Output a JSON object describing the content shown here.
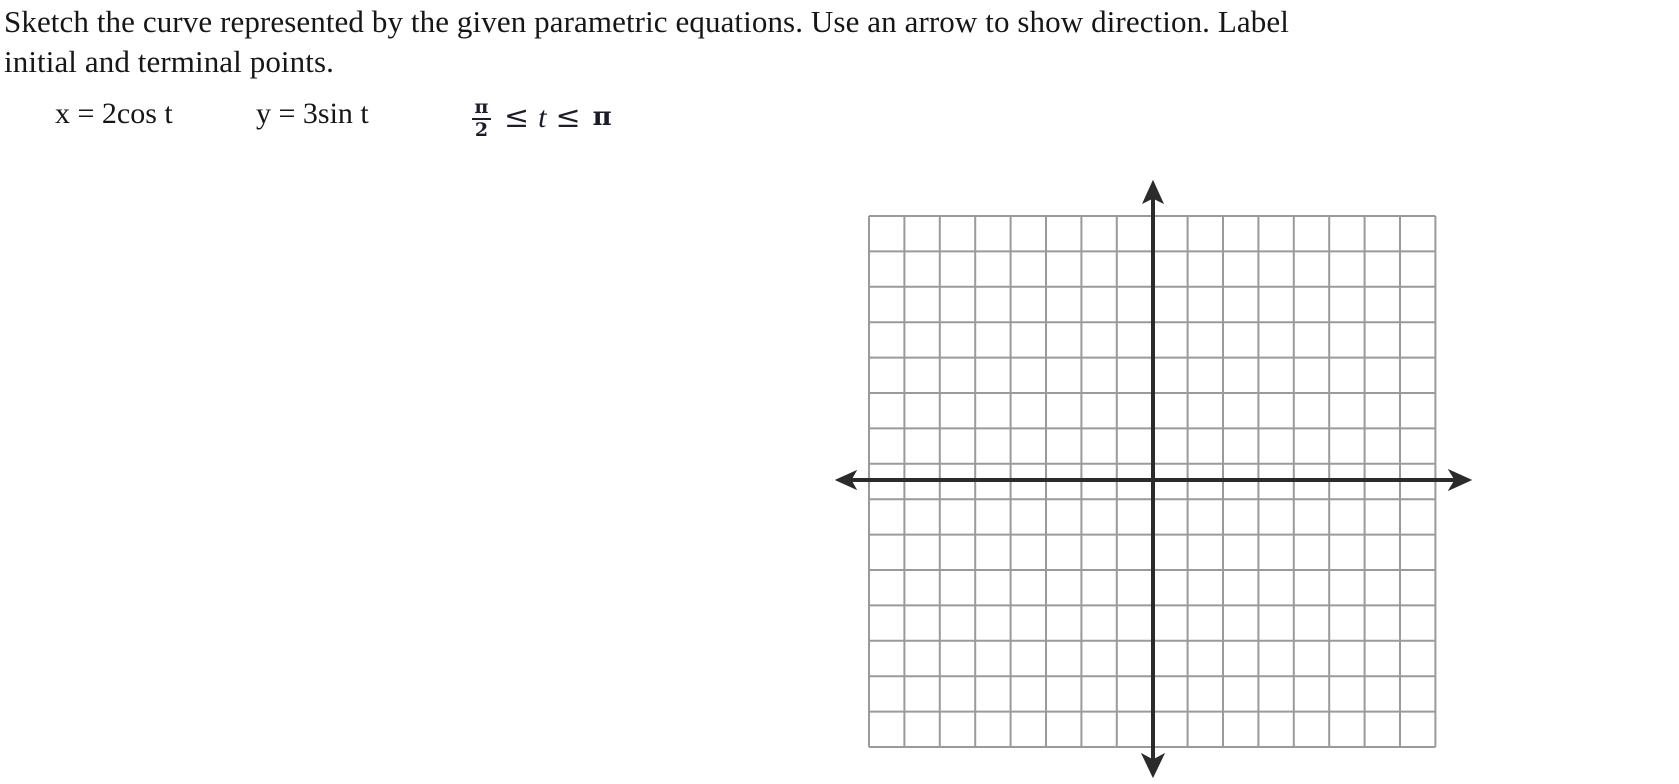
{
  "problem": {
    "line1": "Sketch the curve represented by the given parametric equations. Use an arrow to show direction. Label",
    "line2": "initial and terminal points."
  },
  "equations": {
    "x_equation": "x = 2cos t",
    "y_equation": "y = 3sin t",
    "domain": {
      "numerator": "π",
      "denominator": "2",
      "relation_left": "≤",
      "parameter": "t",
      "relation_right": "≤",
      "upper_bound": "π",
      "full_text": "π/2 ≤ t ≤ π"
    }
  },
  "graph": {
    "label": "blank coordinate grid",
    "grid": {
      "columns": 16,
      "rows": 15,
      "cell_size_px": 35.4,
      "columns_left_of_y_axis": 8,
      "columns_right_of_y_axis": 8,
      "rows_above_x_axis": 7,
      "rows_below_x_axis": 8,
      "line_color": "#9a9a9a",
      "border_color": "#8a8a8a"
    },
    "axes": {
      "color": "#2b2b2b",
      "x_axis_label": "x-axis",
      "y_axis_label": "y-axis",
      "arrow_directions": [
        "left",
        "right",
        "up",
        "down"
      ]
    }
  },
  "colors": {
    "page_background": "#ffffff",
    "text": "#161616",
    "grid_line": "#9a9a9a",
    "axis_line": "#2b2b2b"
  }
}
